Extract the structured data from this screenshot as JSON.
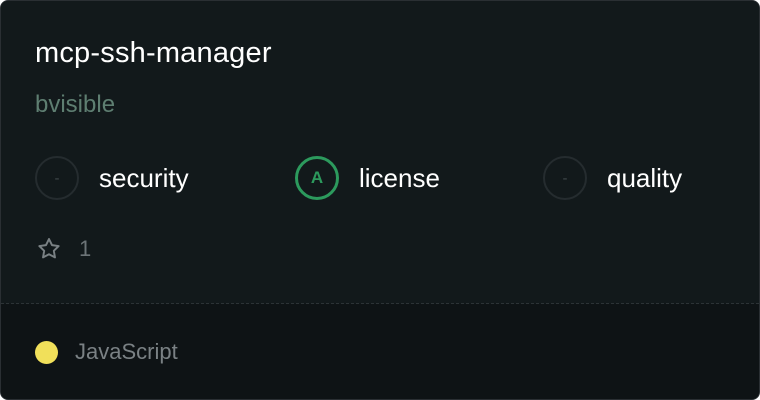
{
  "repo": {
    "name": "mcp-ssh-manager",
    "owner": "bvisible"
  },
  "scores": [
    {
      "grade": "-",
      "label": "security",
      "status": "none"
    },
    {
      "grade": "A",
      "label": "license",
      "status": "graded"
    },
    {
      "grade": "-",
      "label": "quality",
      "status": "none"
    }
  ],
  "stars": {
    "count": "1",
    "icon": "star-outline-icon"
  },
  "language": {
    "name": "JavaScript",
    "color": "#f1e05a"
  },
  "colors": {
    "card_background": "#111719",
    "grade_a": "#2c9a5d",
    "owner_text": "#5e7e71"
  }
}
